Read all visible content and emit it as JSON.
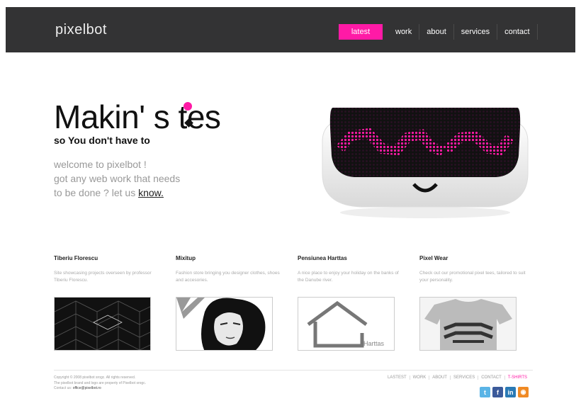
{
  "brand": {
    "logo": "pixelbot"
  },
  "nav": {
    "items": [
      "latest",
      "work",
      "about",
      "services",
      "contact"
    ]
  },
  "hero": {
    "headline": "Makin' s tes",
    "tagline": "so You don't have to",
    "intro_line1": "welcome to pixelbot !",
    "intro_line2": "got any web work that needs",
    "intro_line3": "to be done ? let us",
    "intro_link": "know."
  },
  "projects": [
    {
      "title": "Tiberiu Florescu",
      "desc": "Site showcasing projects overseen by professor Tiberiu Florescu."
    },
    {
      "title": "Mixitup",
      "desc": "Fashion store bringing you designer clothes, shoes and accesories."
    },
    {
      "title": "Pensiunea Harttas",
      "desc": "A nice place to enjoy your holiday on the banks of the Danube river."
    },
    {
      "title": "Pixel Wear",
      "desc": "Check out our promotional pixel tees, tailored to suit your personality."
    }
  ],
  "thumb_labels": {
    "harttas": "Harttas"
  },
  "footer": {
    "copy1": "Copyright © 2008 pixelbot srogc. All rights reserved.",
    "copy2": "The pixelbot brand and logo are property of Pixelbot srogc.",
    "copy3_label": "Contact us:",
    "copy3_email": "office@pixelbot.ro",
    "links": [
      "LASTEST",
      "WORK",
      "ABOUT",
      "SERVICES",
      "CONTACT",
      "T-SHIRTS"
    ]
  },
  "colors": {
    "accent": "#ff1aa6",
    "header_bg": "#333334"
  },
  "social_icons": [
    "twitter-icon",
    "facebook-icon",
    "linkedin-icon",
    "rss-icon"
  ]
}
